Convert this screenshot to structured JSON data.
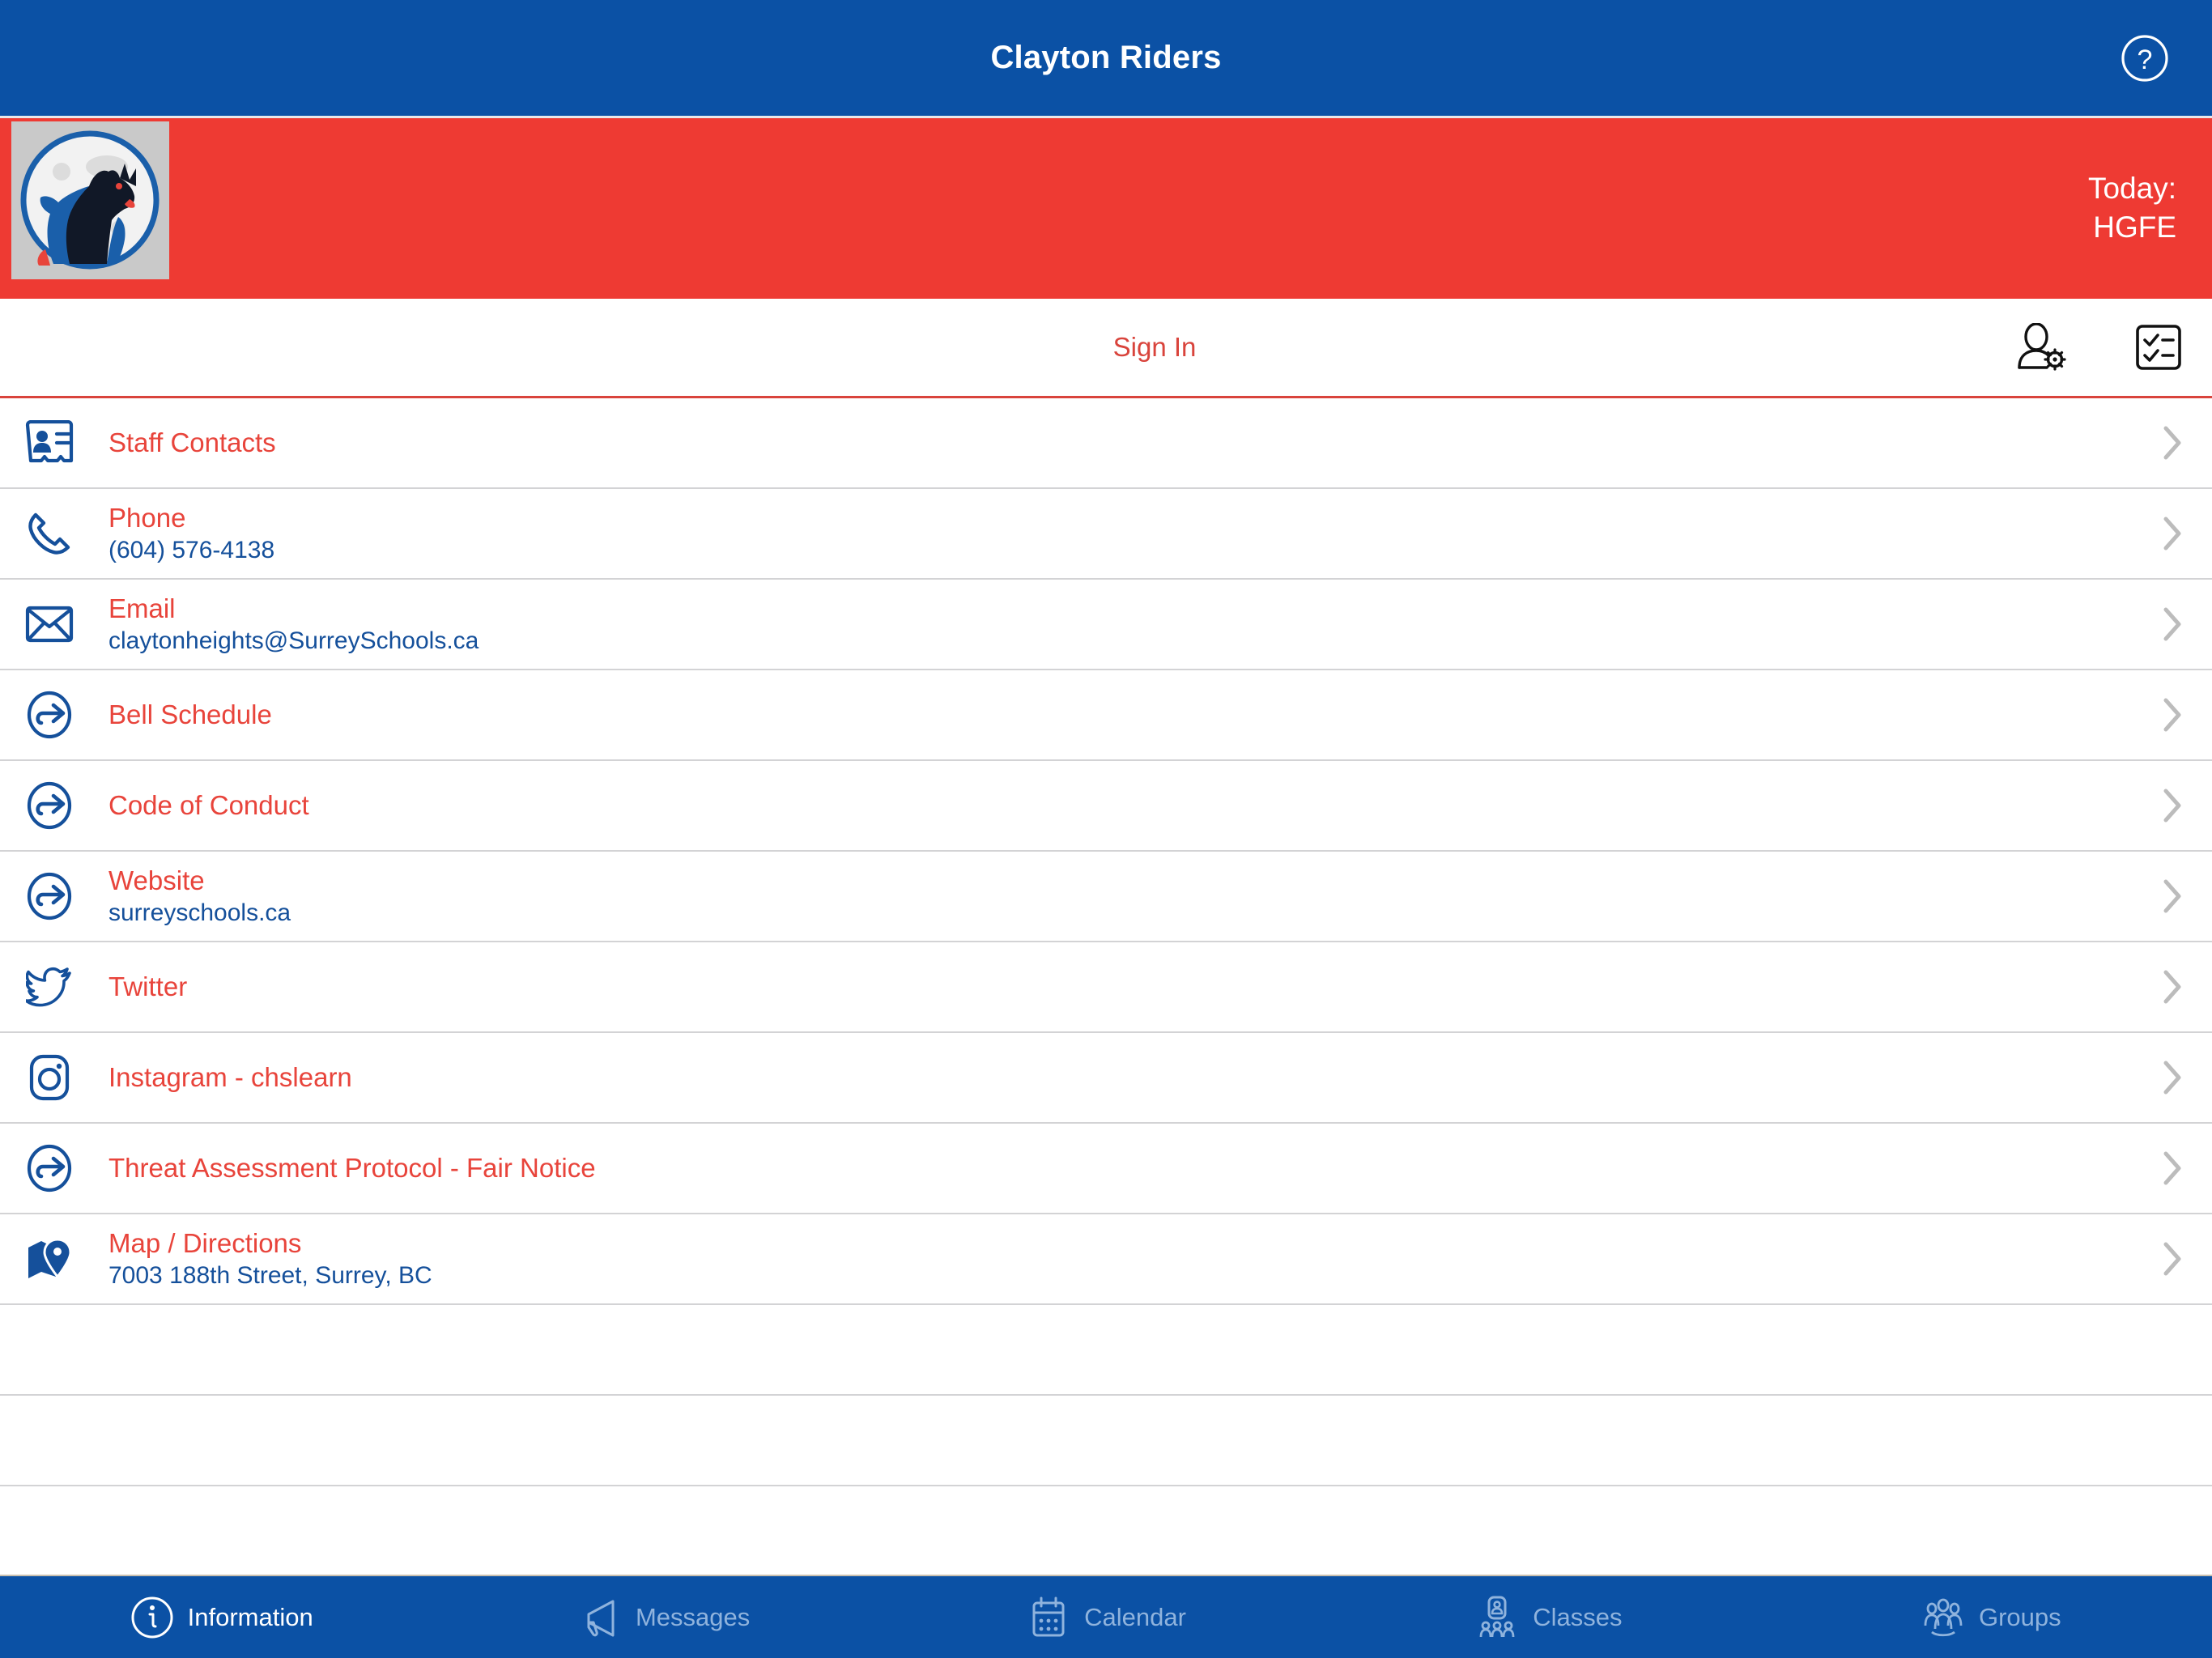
{
  "header": {
    "title": "Clayton Riders",
    "help_icon": "help-circle-icon",
    "bg_color": "#0b51a5"
  },
  "banner": {
    "logo_alt": "clayton-riders-horse-logo",
    "today_label": "Today:",
    "today_value": "HGFE",
    "bg_color": "#ee3a33"
  },
  "signin": {
    "label": "Sign In",
    "account_icon": "user-settings-icon",
    "tasks_icon": "checklist-icon"
  },
  "list": {
    "items": [
      {
        "icon": "contact-card-icon",
        "title": "Staff Contacts",
        "subtitle": "",
        "chevron": "chevron-right-icon"
      },
      {
        "icon": "phone-icon",
        "title": "Phone",
        "subtitle": "(604) 576-4138",
        "chevron": "chevron-right-icon"
      },
      {
        "icon": "envelope-icon",
        "title": "Email",
        "subtitle": "claytonheights@SurreySchools.ca",
        "chevron": "chevron-right-icon"
      },
      {
        "icon": "external-link-icon",
        "title": "Bell Schedule",
        "subtitle": "",
        "chevron": "chevron-right-icon"
      },
      {
        "icon": "external-link-icon",
        "title": "Code of Conduct",
        "subtitle": "",
        "chevron": "chevron-right-icon"
      },
      {
        "icon": "external-link-icon",
        "title": "Website",
        "subtitle": "surreyschools.ca",
        "chevron": "chevron-right-icon"
      },
      {
        "icon": "twitter-bird-icon",
        "title": "Twitter",
        "subtitle": "",
        "chevron": "chevron-right-icon"
      },
      {
        "icon": "instagram-icon",
        "title": "Instagram - chslearn",
        "subtitle": "",
        "chevron": "chevron-right-icon"
      },
      {
        "icon": "external-link-icon",
        "title": "Threat Assessment Protocol - Fair Notice",
        "subtitle": "",
        "chevron": "chevron-right-icon"
      },
      {
        "icon": "map-pin-icon",
        "title": "Map / Directions",
        "subtitle": "7003 188th Street, Surrey, BC",
        "chevron": "chevron-right-icon"
      }
    ]
  },
  "tabbar": {
    "tabs": [
      {
        "label": "Information",
        "icon": "info-circle-icon",
        "active": true
      },
      {
        "label": "Messages",
        "icon": "megaphone-icon",
        "active": false
      },
      {
        "label": "Calendar",
        "icon": "calendar-icon",
        "active": false
      },
      {
        "label": "Classes",
        "icon": "classes-icon",
        "active": false
      },
      {
        "label": "Groups",
        "icon": "groups-icon",
        "active": false
      }
    ]
  },
  "colors": {
    "brand_blue": "#0b51a5",
    "brand_red": "#ee3a33",
    "link_red": "#e8443b",
    "sub_blue": "#15509b",
    "separator": "#d3d3d5"
  }
}
